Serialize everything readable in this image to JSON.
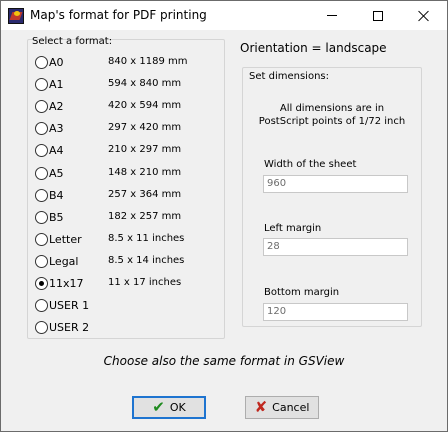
{
  "window": {
    "title": "Map's format for PDF printing",
    "controls": {
      "minimize": "minimize",
      "maximize": "maximize",
      "close": "close"
    }
  },
  "format_group": {
    "title": "Select a format:",
    "selected": "11x17",
    "options": [
      {
        "label": "A0",
        "dims": "840 x 1189  mm",
        "checked": false
      },
      {
        "label": "A1",
        "dims": "594 x 840  mm",
        "checked": false
      },
      {
        "label": "A2",
        "dims": "420 x 594  mm",
        "checked": false
      },
      {
        "label": "A3",
        "dims": "297 x 420  mm",
        "checked": false
      },
      {
        "label": "A4",
        "dims": "210 x 297  mm",
        "checked": false
      },
      {
        "label": "A5",
        "dims": "148 x 210  mm",
        "checked": false
      },
      {
        "label": "B4",
        "dims": "257 x 364  mm",
        "checked": false
      },
      {
        "label": "B5",
        "dims": "182 x 257  mm",
        "checked": false
      },
      {
        "label": "Letter",
        "dims": "8.5 x 11  inches",
        "checked": false
      },
      {
        "label": "Legal",
        "dims": "8.5 x 14  inches",
        "checked": false
      },
      {
        "label": "11x17",
        "dims": "11 x 17  inches",
        "checked": true
      },
      {
        "label": "USER 1",
        "dims": "",
        "checked": false
      },
      {
        "label": "USER 2",
        "dims": "",
        "checked": false
      }
    ]
  },
  "orientation": {
    "text": "Orientation = landscape"
  },
  "dimensions": {
    "title": "Set dimensions:",
    "note_line1": "All dimensions are in",
    "note_line2": "PostScript points of 1/72 inch",
    "width_label": "Width of the sheet",
    "width_value": "960",
    "left_margin_label": "Left margin",
    "left_margin_value": "28",
    "bottom_margin_label": "Bottom margin",
    "bottom_margin_value": "120"
  },
  "gsview_note": "Choose also the same format in GSView",
  "buttons": {
    "ok": "OK",
    "cancel": "Cancel"
  },
  "icons": {
    "app": "app-map-icon",
    "ok": "checkmark-icon",
    "cancel": "x-icon"
  },
  "colors": {
    "ok_check": "#1f8a1f",
    "cancel_x": "#c0281f",
    "default_button_border": "#1e74d0"
  }
}
